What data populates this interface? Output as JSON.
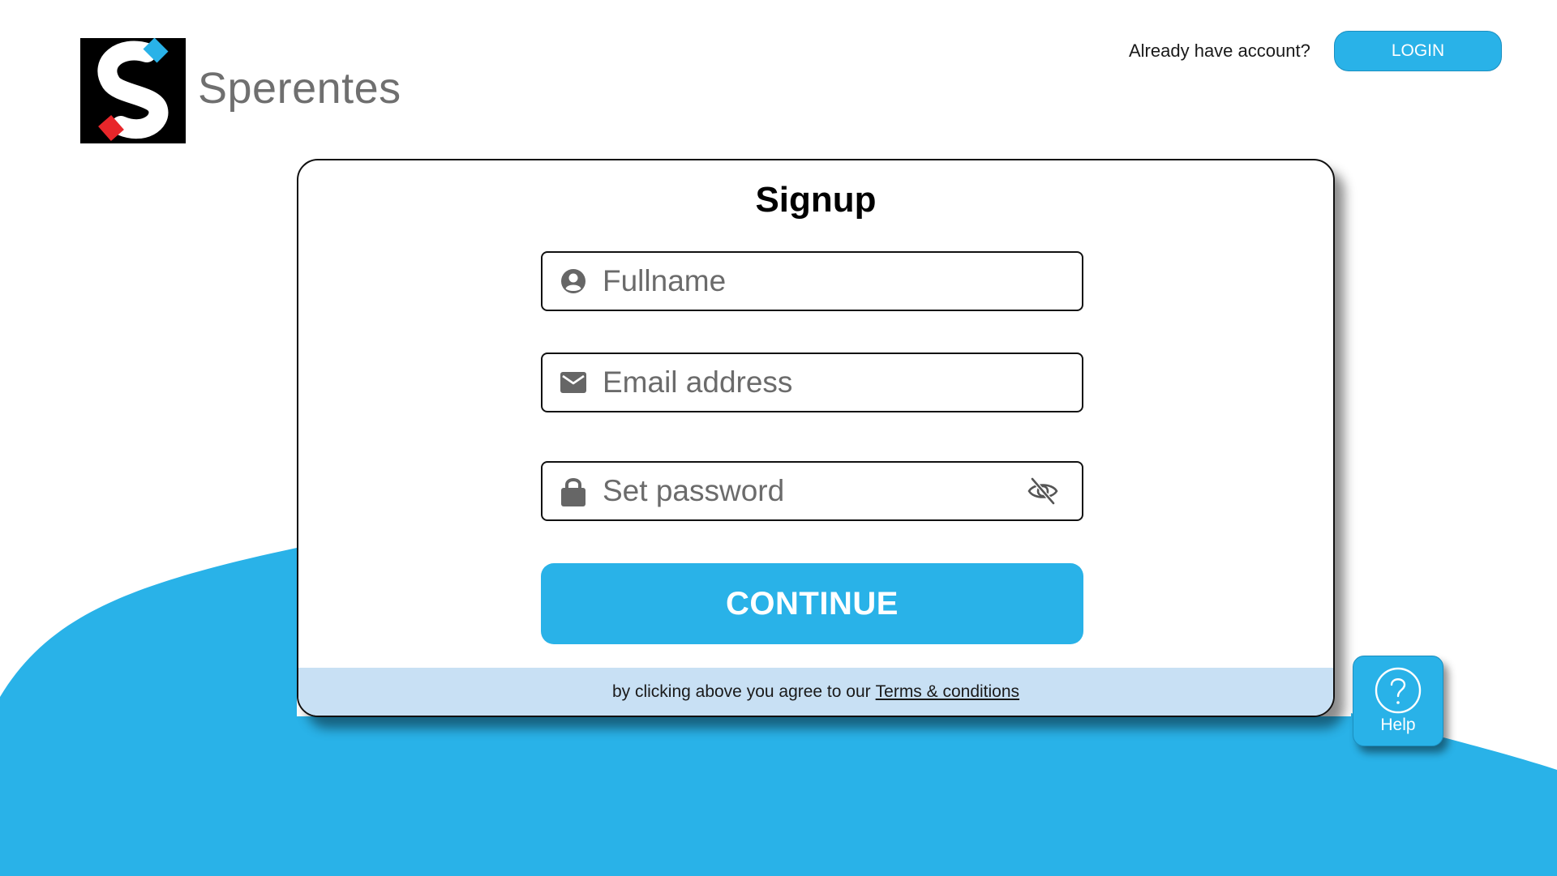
{
  "brand": {
    "name": "Sperentes",
    "logo_icon": "s-logo-icon"
  },
  "header": {
    "already_text": "Already have account?",
    "login_label": "LOGIN"
  },
  "signup": {
    "title": "Signup",
    "fields": {
      "fullname": {
        "placeholder": "Fullname",
        "icon": "user-circle-icon",
        "value": ""
      },
      "email": {
        "placeholder": "Email address",
        "icon": "mail-icon",
        "value": ""
      },
      "password": {
        "placeholder": "Set password",
        "icon": "lock-icon",
        "toggle_icon": "eye-off-icon",
        "value": ""
      }
    },
    "continue_label": "CONTINUE",
    "terms_prefix": "by clicking above you agree to our",
    "terms_link": "Terms & conditions"
  },
  "help": {
    "label": "Help",
    "icon": "question-circle-icon"
  },
  "colors": {
    "accent": "#29b2e8",
    "terms_bar": "#c8e0f4",
    "placeholder": "#6b6b6b",
    "logo_red": "#e8262a",
    "logo_blue": "#29b2e8"
  }
}
